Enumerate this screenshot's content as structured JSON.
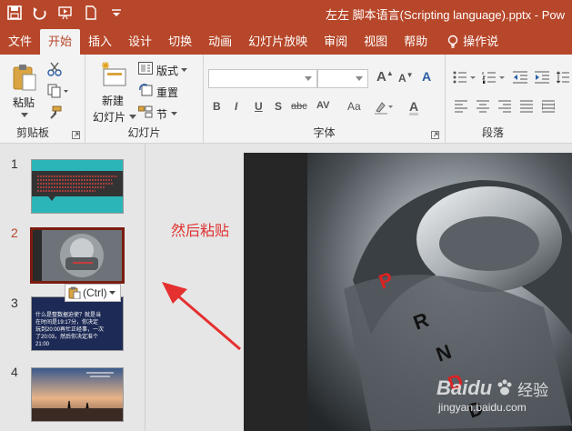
{
  "window": {
    "title": "左左 脚本语言(Scripting language).pptx - Pow"
  },
  "colors": {
    "accent": "#b7472a",
    "annotation": "#e03030",
    "thumb1_bg": "#2bb5b8"
  },
  "tabs": [
    {
      "label": "文件",
      "active": false
    },
    {
      "label": "开始",
      "active": true
    },
    {
      "label": "插入",
      "active": false
    },
    {
      "label": "设计",
      "active": false
    },
    {
      "label": "切换",
      "active": false
    },
    {
      "label": "动画",
      "active": false
    },
    {
      "label": "幻灯片放映",
      "active": false
    },
    {
      "label": "审阅",
      "active": false
    },
    {
      "label": "视图",
      "active": false
    },
    {
      "label": "帮助",
      "active": false
    },
    {
      "label": "操作说",
      "active": false
    }
  ],
  "ribbon": {
    "clipboard": {
      "paste_label": "粘贴",
      "group_label": "剪贴板"
    },
    "slides": {
      "new_slide_line1": "新建",
      "new_slide_line2": "幻灯片",
      "layout_label": "版式",
      "reset_label": "重置",
      "section_label": "节",
      "group_label": "幻灯片"
    },
    "font": {
      "group_label": "字体",
      "format_buttons": [
        "B",
        "I",
        "U",
        "S",
        "abc",
        "AV",
        "Aa",
        "A"
      ]
    },
    "paragraph": {
      "group_label": "段落"
    }
  },
  "slides_panel": {
    "slides": [
      {
        "number": "1",
        "selected": false
      },
      {
        "number": "2",
        "selected": true
      },
      {
        "number": "3",
        "selected": false
      },
      {
        "number": "4",
        "selected": false
      }
    ],
    "thumb3_text": [
      "什么是整数据迫使？就是当",
      "在时间是19:17分，你决定",
      "玩到20:00再忙正经事，一次",
      "了20:03，然后你决定准个",
      "21:00"
    ],
    "thumb3_badge": "(Ctrl)",
    "paste_options_label": "(Ctrl)"
  },
  "annotation": {
    "text": "然后粘贴"
  },
  "watermark": {
    "brand": "Baidu",
    "brand_cn": "经验",
    "url": "jingyan.baidu.com"
  }
}
